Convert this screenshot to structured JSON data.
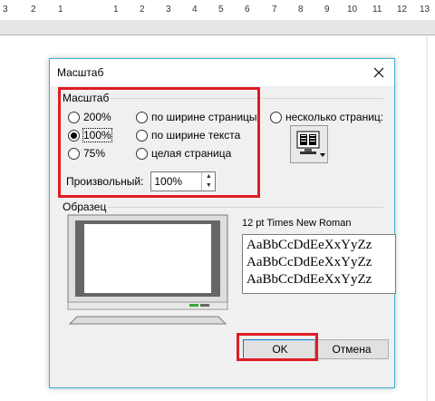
{
  "ruler": {
    "ticks": [
      "3",
      "2",
      "1",
      "1",
      "2",
      "3",
      "4",
      "5",
      "6",
      "7",
      "8",
      "9",
      "10",
      "11",
      "12",
      "13"
    ]
  },
  "dialog": {
    "title": "Масштаб",
    "zoom_group": {
      "label": "Масштаб",
      "options": [
        "200%",
        "100%",
        "75%",
        "по ширине страницы",
        "по ширине текста",
        "целая страница",
        "несколько страниц:"
      ],
      "selected": "100%"
    },
    "custom": {
      "label": "Произвольный:",
      "value": "100%"
    },
    "sample_group": {
      "label": "Образец",
      "font_caption": "12 pt Times New Roman",
      "sample_lines": [
        "AaBbCcDdEeXxYyZz",
        "AaBbCcDdEeXxYyZz",
        "AaBbCcDdEeXxYyZz"
      ]
    },
    "buttons": {
      "ok": "OK",
      "cancel": "Отмена"
    }
  },
  "colors": {
    "highlight": "#e01b24",
    "accent_border": "#39b3cf",
    "default_button": "#0078d7"
  }
}
